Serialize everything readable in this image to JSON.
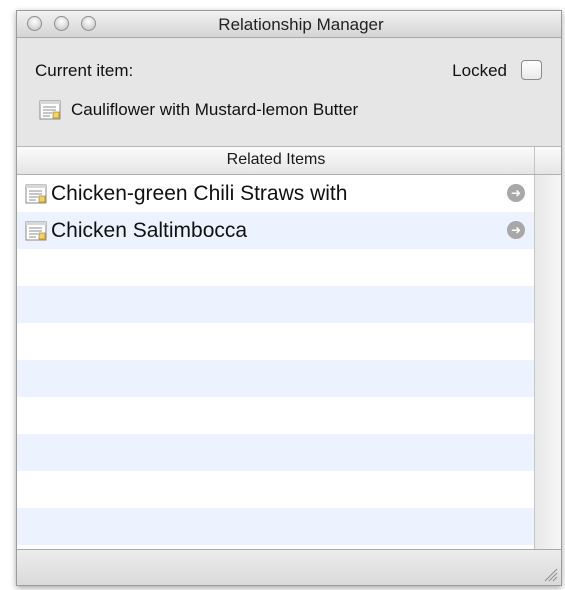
{
  "window": {
    "title": "Relationship Manager"
  },
  "current": {
    "label": "Current item:",
    "item_name": "Cauliflower with Mustard-lemon Butter",
    "item_icon": "document-icon"
  },
  "locked": {
    "label": "Locked",
    "checked": false
  },
  "related": {
    "header": "Related Items",
    "items": [
      {
        "label": "Chicken-green Chili Straws with",
        "icon": "document-icon",
        "action_icon": "go-arrow-icon"
      },
      {
        "label": "Chicken Saltimbocca",
        "icon": "document-icon",
        "action_icon": "go-arrow-icon"
      }
    ]
  },
  "colors": {
    "stripe": "#edf3fe",
    "window_bg": "#e6e6e6"
  }
}
